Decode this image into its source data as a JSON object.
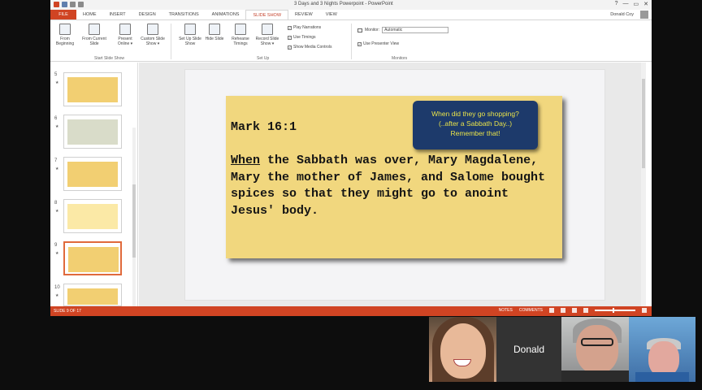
{
  "titlebar": {
    "title": "3 Days and 3 Nights Powerpoint - PowerPoint",
    "help": "?",
    "minimize": "—",
    "restore": "▭",
    "close": "✕"
  },
  "tabs": {
    "file": "FILE",
    "items": [
      "HOME",
      "INSERT",
      "DESIGN",
      "TRANSITIONS",
      "ANIMATIONS",
      "SLIDE SHOW",
      "REVIEW",
      "VIEW"
    ],
    "active": "SLIDE SHOW",
    "user": "Donald Coy"
  },
  "ribbon": {
    "start": {
      "buttons": [
        "From Beginning",
        "From Current Slide",
        "Present Online ▾",
        "Custom Slide Show ▾"
      ],
      "label": "Start Slide Show"
    },
    "setup": {
      "buttons": [
        "Set Up Slide Show",
        "Hide Slide",
        "Rehearse Timings",
        "Record Slide Show ▾"
      ],
      "checks": [
        "Play Narrations",
        "Use Timings",
        "Show Media Controls"
      ],
      "label": "Set Up"
    },
    "monitors": {
      "monitor_label": "Monitor:",
      "monitor_value": "Automatic",
      "presenter_view": "Use Presenter View",
      "label": "Monitors"
    }
  },
  "thumbnails": [
    {
      "num": "5",
      "star": "★"
    },
    {
      "num": "6",
      "star": "★"
    },
    {
      "num": "7",
      "star": "★"
    },
    {
      "num": "8",
      "star": "★"
    },
    {
      "num": "9",
      "star": "★"
    },
    {
      "num": "10",
      "star": "★"
    }
  ],
  "slide": {
    "callout_line1": "When did they go shopping?",
    "callout_line2": "(..after a Sabbath Day..)",
    "callout_line3": "Remember that!",
    "heading": "Mark 16:1",
    "verse_first_word": "When",
    "verse_rest": " the Sabbath was over, Mary Magdalene, Mary the mother of James, and Salome bought spices so that they might go to anoint Jesus' body."
  },
  "status": {
    "slide_position": "SLIDE 9 OF 17",
    "notes": "NOTES",
    "comments": "COMMENTS"
  },
  "video": {
    "name_tile": "Donald"
  },
  "colors": {
    "accent": "#d04423",
    "card": "#f1d77e",
    "callout_bg": "#1d3a6b",
    "callout_text": "#e8e24a"
  }
}
